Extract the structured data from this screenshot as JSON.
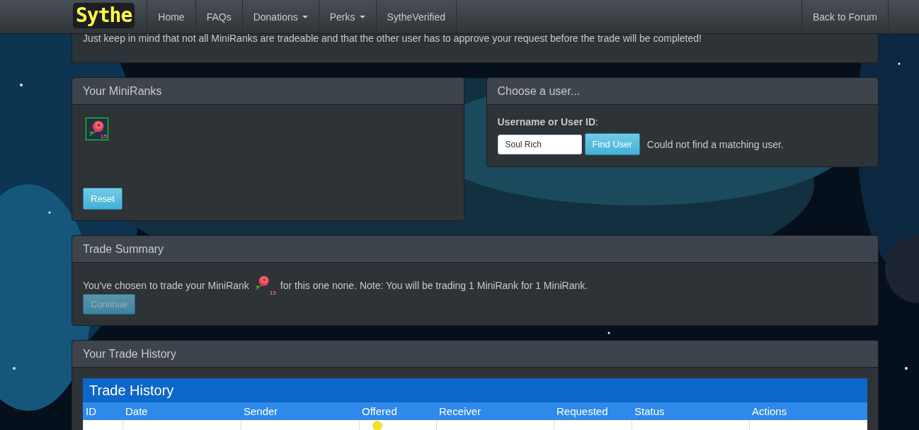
{
  "navbar": {
    "brand": "Sythe",
    "items": [
      {
        "label": "Home",
        "dropdown": false
      },
      {
        "label": "FAQs",
        "dropdown": false
      },
      {
        "label": "Donations",
        "dropdown": true
      },
      {
        "label": "Perks",
        "dropdown": true
      },
      {
        "label": "SytheVerified",
        "dropdown": false
      }
    ],
    "right_item": "Back to Forum"
  },
  "intro_panel": {
    "text": "Just keep in mind that not all MiniRanks are tradeable and that the other user has to approve your request before the trade will be completed!"
  },
  "miniranks_panel": {
    "title": "Your MiniRanks",
    "items": [
      {
        "number": "15",
        "selected": true
      }
    ],
    "reset_button": "Reset"
  },
  "choose_user_panel": {
    "title": "Choose a user...",
    "field_label": "**Username or User ID**:",
    "input_value": "Soul Rich",
    "find_button": "Find User",
    "message": "Could not find a matching user."
  },
  "trade_summary_panel": {
    "title": "Trade Summary",
    "text_before": "You've chosen to trade your MiniRank",
    "rank_number": "15",
    "text_after": "for this one none. Note: You will be trading 1 MiniRank for 1 MiniRank.",
    "continue_button": {
      "label": "Continue",
      "disabled": true
    }
  },
  "trade_history_panel": {
    "title": "Your Trade History",
    "table": {
      "title": "Trade History",
      "columns": [
        "ID",
        "Date",
        "Sender",
        "Offered",
        "Receiver",
        "Requested",
        "Status",
        "Actions"
      ],
      "rows": [
        {
          "offered_icon": true
        }
      ]
    }
  }
}
